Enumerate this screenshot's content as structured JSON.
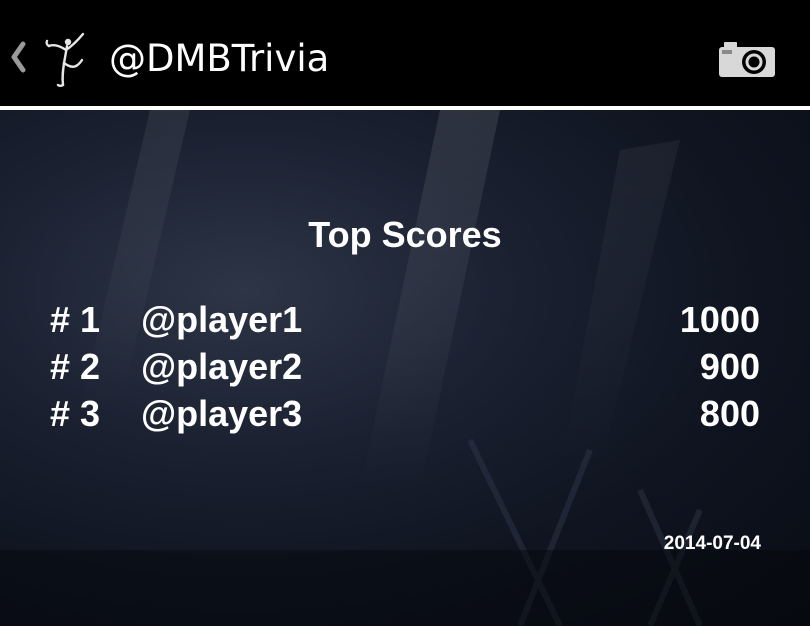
{
  "action_bar": {
    "title": "@DMBTrivia",
    "up_icon": "chevron-left-icon",
    "logo_icon": "firedancer-logo",
    "camera_icon": "camera-icon",
    "background_color": "#000000",
    "divider_color": "#ffffff"
  },
  "scores": {
    "title": "Top Scores",
    "entries": [
      {
        "rank": "# 1",
        "player": "@player1",
        "score": "1000"
      },
      {
        "rank": "# 2",
        "player": "@player2",
        "score": "900"
      },
      {
        "rank": "# 3",
        "player": "@player3",
        "score": "800"
      }
    ],
    "date": "2014-07-04"
  }
}
